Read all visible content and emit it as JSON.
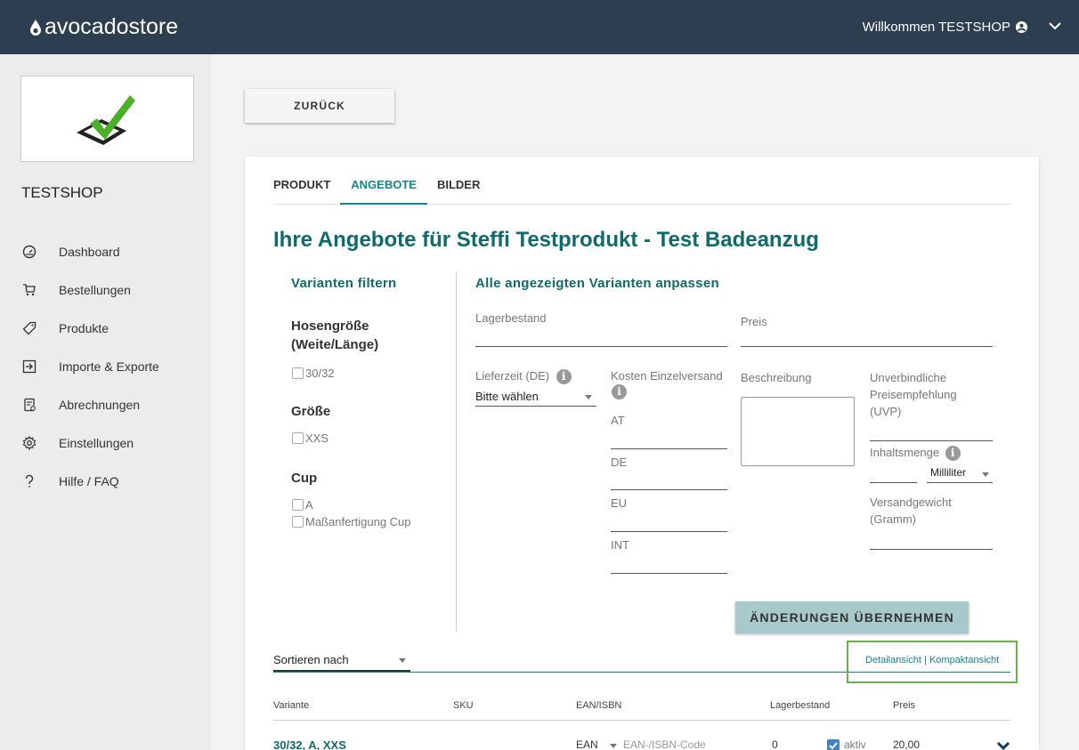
{
  "header": {
    "logo_text": "avocadostore",
    "welcome": "Willkommen TESTSHOP"
  },
  "sidebar": {
    "shop_name": "TESTSHOP",
    "items": [
      {
        "label": "Dashboard",
        "icon": "dashboard-icon"
      },
      {
        "label": "Bestellungen",
        "icon": "cart-icon"
      },
      {
        "label": "Produkte",
        "icon": "tag-icon"
      },
      {
        "label": "Importe & Exporte",
        "icon": "import-icon"
      },
      {
        "label": "Abrechnungen",
        "icon": "invoice-icon"
      },
      {
        "label": "Einstellungen",
        "icon": "gear-icon"
      },
      {
        "label": "Hilfe / FAQ",
        "icon": "help-icon"
      }
    ]
  },
  "back_button": "ZURÜCK",
  "tabs": [
    "PRODUKT",
    "ANGEBOTE",
    "BILDER"
  ],
  "page_title": "Ihre Angebote für Steffi Testprodukt - Test Badeanzug",
  "filter": {
    "title": "Varianten filtern",
    "groups": [
      {
        "title": "Hosengröße (Weite/Länge)",
        "options": [
          "30/32"
        ]
      },
      {
        "title": "Größe",
        "options": [
          "XXS"
        ]
      },
      {
        "title": "Cup",
        "options": [
          "A",
          "Maßanfertigung Cup"
        ]
      }
    ]
  },
  "adjust": {
    "title": "Alle angezeigten Varianten anpassen",
    "lagerbestand": "Lagerbestand",
    "preis": "Preis",
    "lieferzeit": "Lieferzeit (DE)",
    "lieferzeit_value": "Bitte wählen",
    "kosten": "Kosten Einzelversand",
    "kosten_regions": [
      "AT",
      "DE",
      "EU",
      "INT"
    ],
    "beschreibung": "Beschreibung",
    "uvp": "Unverbindliche Preisempfehlung (UVP)",
    "inhaltsmenge": "Inhaltsmenge",
    "unit": "Milliliter",
    "versandgewicht": "Versandgewicht (Gramm)",
    "apply": "ÄNDERUNGEN ÜBERNEHMEN"
  },
  "sort": {
    "label": "Sortieren nach",
    "view_links": "Detailansicht | Kompaktansicht"
  },
  "table": {
    "headers": [
      "Variante",
      "SKU",
      "EAN/ISBN",
      "Lagerbestand",
      "Preis"
    ],
    "row": {
      "variant": "30/32, A, XXS",
      "ean_type": "EAN",
      "ean_placeholder": "EAN-/ISBN-Code",
      "lagerbestand": "0",
      "aktiv": "aktiv",
      "preis": "20,00"
    }
  },
  "colors": {
    "header_bg": "#2c3e4f",
    "accent": "#13868c",
    "title": "#0e6b6c",
    "apply_btn": "#a7c9cc",
    "highlight_box": "#6ab04c"
  }
}
